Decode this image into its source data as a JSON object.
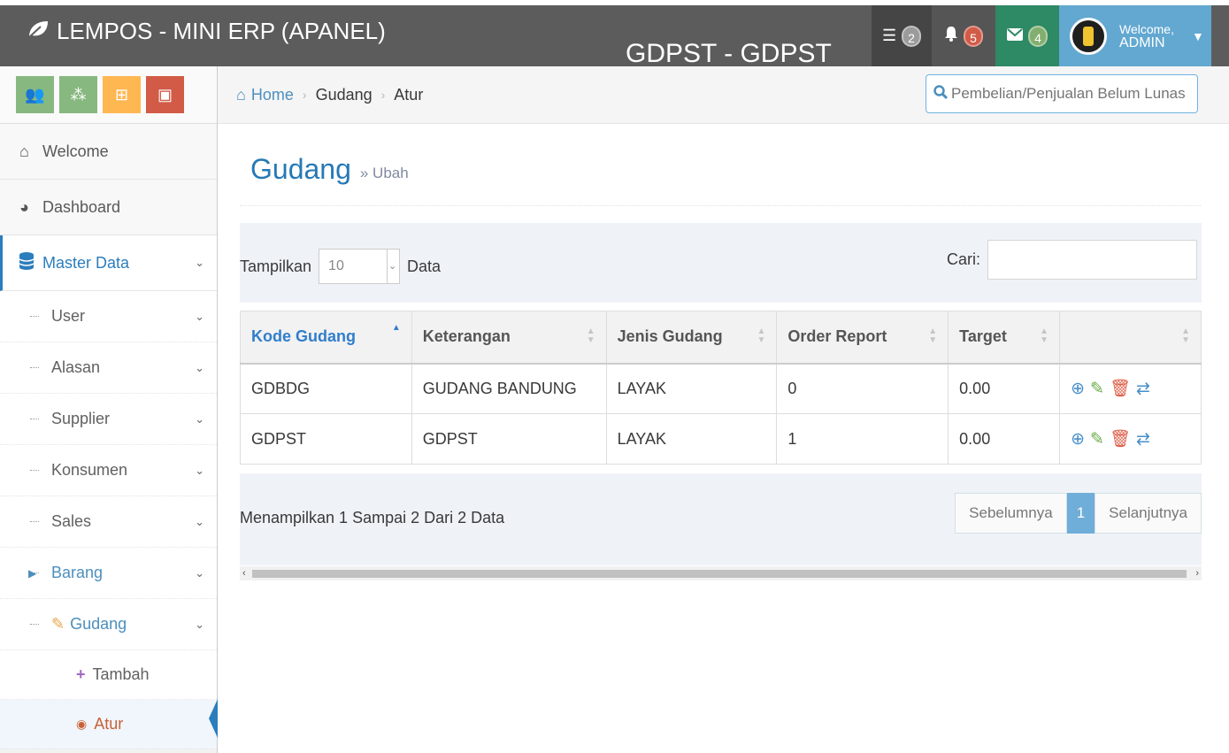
{
  "navbar": {
    "brand": "LEMPOS - MINI ERP (APANEL)",
    "center_title": "GDPST - GDPST",
    "tasks_count": "2",
    "notifications_count": "5",
    "messages_count": "4",
    "welcome": "Welcome,",
    "user_name": "ADMIN",
    "colors": {
      "bar": "#5c5c5c",
      "messages": "#2e8965",
      "user": "#62a8d1",
      "notif_badge": "#d15b47",
      "msg_badge": "#82af6f"
    }
  },
  "shortcuts": [
    {
      "icon": "users-icon",
      "color": "#87b87f"
    },
    {
      "icon": "cubes-icon",
      "color": "#87b87f"
    },
    {
      "icon": "basket-icon",
      "color": "#ffb752"
    },
    {
      "icon": "money-icon",
      "color": "#d15b47"
    }
  ],
  "breadcrumb": {
    "home": "Home",
    "level1": "Gudang",
    "level2": "Atur"
  },
  "search": {
    "placeholder": "Pembelian/Penjualan Belum Lunas"
  },
  "sidebar": {
    "menu": [
      {
        "label": "Welcome",
        "icon": "home-icon"
      },
      {
        "label": "Dashboard",
        "icon": "dashboard-icon"
      },
      {
        "label": "Master Data",
        "icon": "database-icon"
      }
    ],
    "sub": [
      "User",
      "Alasan",
      "Supplier",
      "Konsumen",
      "Sales",
      "Barang",
      "Gudang"
    ],
    "subsub": [
      "Tambah",
      "Atur"
    ]
  },
  "page": {
    "title": "Gudang",
    "subtitle": "» Ubah"
  },
  "controls": {
    "show_label": "Tampilkan",
    "page_size": "10",
    "data_label": "Data",
    "search_label": "Cari:"
  },
  "table": {
    "headers": [
      "Kode Gudang",
      "Keterangan",
      "Jenis Gudang",
      "Order Report",
      "Target",
      ""
    ],
    "rows": [
      [
        "GDBDG",
        "GUDANG BANDUNG",
        "LAYAK",
        "0",
        "0.00"
      ],
      [
        "GDPST",
        "GDPST",
        "LAYAK",
        "1",
        "0.00"
      ]
    ]
  },
  "footer": {
    "info": "Menampilkan 1 Sampai 2 Dari 2 Data",
    "prev": "Sebelumnya",
    "current": "1",
    "next": "Selanjutnya"
  }
}
